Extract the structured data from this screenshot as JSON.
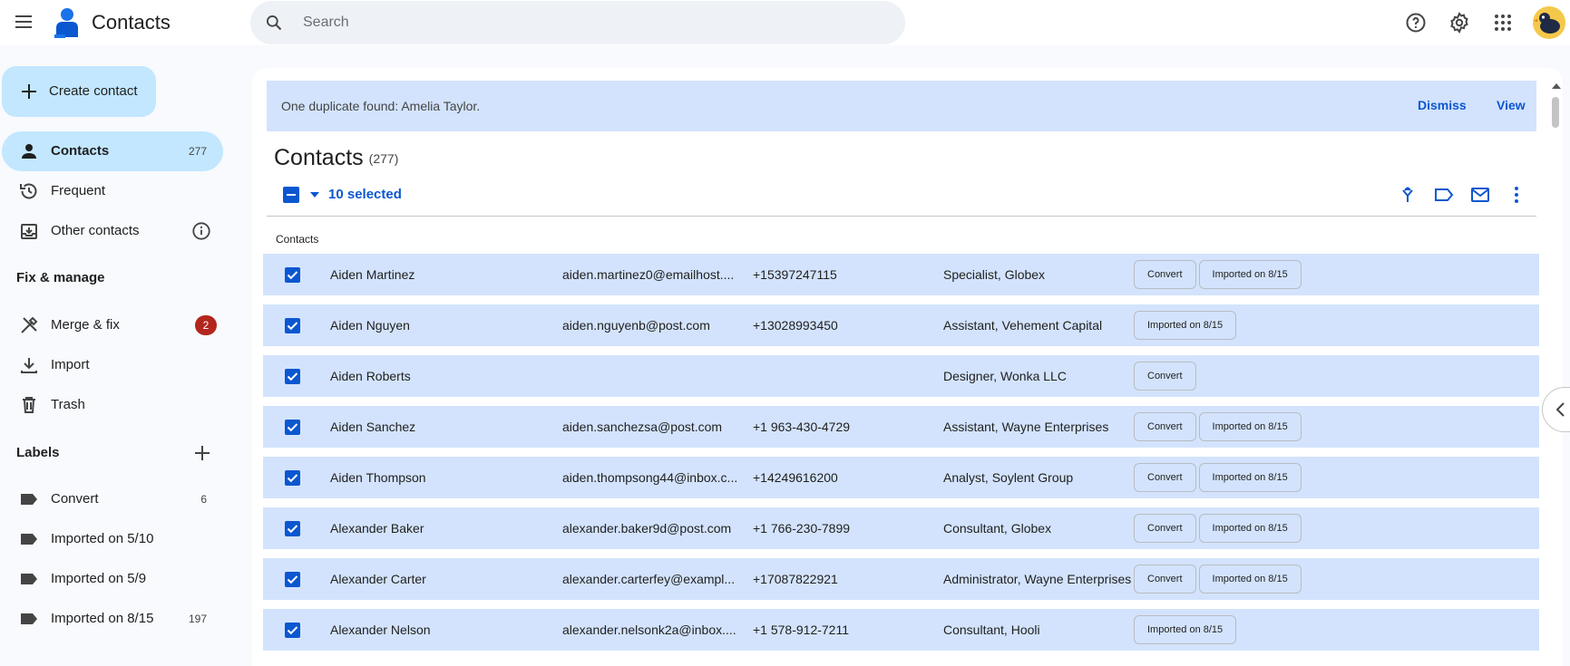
{
  "app": {
    "title": "Contacts"
  },
  "search": {
    "placeholder": "Search"
  },
  "sidebar": {
    "create_label": "Create contact",
    "nav": [
      {
        "label": "Contacts",
        "count": "277",
        "icon": "person-icon"
      },
      {
        "label": "Frequent",
        "icon": "history-icon"
      },
      {
        "label": "Other contacts",
        "icon": "archive-icon"
      }
    ],
    "fix_header": "Fix & manage",
    "fix": [
      {
        "label": "Merge & fix",
        "badge": "2",
        "icon": "merge-icon"
      },
      {
        "label": "Import",
        "icon": "download-icon"
      },
      {
        "label": "Trash",
        "icon": "trash-icon"
      }
    ],
    "labels_header": "Labels",
    "labels": [
      {
        "label": "Convert",
        "count": "6"
      },
      {
        "label": "Imported on 5/10",
        "count": ""
      },
      {
        "label": "Imported on 5/9",
        "count": ""
      },
      {
        "label": "Imported on 8/15",
        "count": "197"
      }
    ]
  },
  "banner": {
    "message": "One duplicate found: Amelia Taylor.",
    "dismiss": "Dismiss",
    "view": "View"
  },
  "main": {
    "heading": "Contacts",
    "count": "(277)",
    "selected_text": "10 selected",
    "column_label": "Contacts"
  },
  "rows": [
    {
      "name": "Aiden Martinez",
      "email": "aiden.martinez0@emailhost....",
      "phone": "+15397247115",
      "job": "Specialist, Globex",
      "chips": [
        "Convert",
        "Imported on 8/15"
      ]
    },
    {
      "name": "Aiden Nguyen",
      "email": "aiden.nguyenb@post.com",
      "phone": "+13028993450",
      "job": "Assistant, Vehement Capital",
      "chips": [
        "Imported on 8/15"
      ]
    },
    {
      "name": "Aiden Roberts",
      "email": "",
      "phone": "",
      "job": "Designer, Wonka LLC",
      "chips": [
        "Convert"
      ]
    },
    {
      "name": "Aiden Sanchez",
      "email": "aiden.sanchezsa@post.com",
      "phone": "+1 963-430-4729",
      "job": "Assistant, Wayne Enterprises",
      "chips": [
        "Convert",
        "Imported on 8/15"
      ]
    },
    {
      "name": "Aiden Thompson",
      "email": "aiden.thompsong44@inbox.c...",
      "phone": "+14249616200",
      "job": "Analyst, Soylent Group",
      "chips": [
        "Convert",
        "Imported on 8/15"
      ]
    },
    {
      "name": "Alexander Baker",
      "email": "alexander.baker9d@post.com",
      "phone": "+1 766-230-7899",
      "job": "Consultant, Globex",
      "chips": [
        "Convert",
        "Imported on 8/15"
      ]
    },
    {
      "name": "Alexander Carter",
      "email": "alexander.carterfey@exampl...",
      "phone": "+17087822921",
      "job": "Administrator, Wayne Enterprises",
      "chips": [
        "Convert",
        "Imported on 8/15"
      ]
    },
    {
      "name": "Alexander Nelson",
      "email": "alexander.nelsonk2a@inbox....",
      "phone": "+1 578-912-7211",
      "job": "Consultant, Hooli",
      "chips": [
        "Imported on 8/15"
      ]
    }
  ],
  "colors": {
    "accent": "#0b57d0",
    "selected_row": "#d3e3fd",
    "active_nav": "#c2e7ff",
    "badge": "#b3261e"
  }
}
